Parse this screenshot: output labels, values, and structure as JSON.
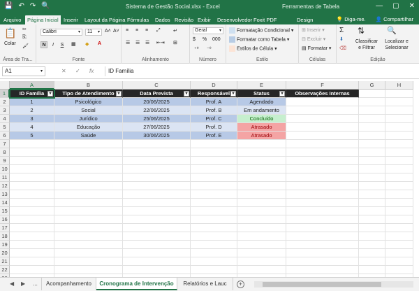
{
  "app": {
    "window_title": "Sistema de Gestão Social.xlsx - Excel",
    "tools_title": "Ferramentas de Tabela",
    "window_controls": [
      "—",
      "▢",
      "✕"
    ]
  },
  "ribbon_tabs": [
    "Arquivo",
    "Página Inicial",
    "Inserir",
    "Layout da Página",
    "Fórmulas",
    "Dados",
    "Revisão",
    "Exibir",
    "Desenvolvedor",
    "Foxit PDF",
    "Design"
  ],
  "ribbon_right": {
    "tell_me": "Diga-me.",
    "share": "Compartilhar"
  },
  "ribbon": {
    "clipboard": {
      "paste": "Colar",
      "label": "Área de Tra..."
    },
    "font": {
      "name": "Calibri",
      "size": "11",
      "bold": "N",
      "italic": "I",
      "underline": "S",
      "label": "Fonte"
    },
    "alignment": {
      "label": "Alinhamento"
    },
    "number": {
      "format": "Geral",
      "percent": "%",
      "thousands": "000",
      "label": "Número"
    },
    "styles": {
      "conditional": "Formatação Condicional",
      "as_table": "Formatar como Tabela",
      "cell_styles": "Estilos de Célula",
      "label": "Estilo"
    },
    "cells": {
      "insert": "Inserir",
      "delete": "Excluir",
      "format": "Formatar",
      "label": "Células"
    },
    "editing": {
      "sort": "Classificar e Filtrar",
      "find": "Localizar e Selecionar",
      "label": "Edição"
    }
  },
  "formula_bar": {
    "name_box": "A1",
    "content": "ID Família"
  },
  "columns": [
    "A",
    "B",
    "C",
    "D",
    "E",
    "F",
    "G",
    "H"
  ],
  "rows": [
    "1",
    "2",
    "3",
    "4",
    "5",
    "6",
    "7",
    "8",
    "9",
    "10",
    "11",
    "12",
    "13",
    "14",
    "15",
    "16",
    "17",
    "18",
    "19",
    "20",
    "21",
    "22",
    "23"
  ],
  "table": {
    "headers": [
      "ID Família",
      "Tipo de Atendimento",
      "Data Prevista",
      "Responsável",
      "Status",
      "Observações Internas"
    ],
    "rows": [
      [
        "1",
        "Psicológico",
        "20/06/2025",
        "Prof. A",
        "Agendado",
        ""
      ],
      [
        "2",
        "Social",
        "22/06/2025",
        "Prof. B",
        "Em andamento",
        ""
      ],
      [
        "3",
        "Jurídico",
        "25/06/2025",
        "Prof. C",
        "Concluído",
        ""
      ],
      [
        "4",
        "Educação",
        "27/06/2025",
        "Prof. D",
        "Atrasado",
        ""
      ],
      [
        "5",
        "Saúde",
        "30/06/2025",
        "Prof. E",
        "Atrasado",
        ""
      ]
    ]
  },
  "sheets": {
    "more": "...",
    "tabs": [
      "Acompanhamento",
      "Cronograma de Intervenção",
      "Relatórios e Lauc"
    ],
    "active": 1
  },
  "colors": {
    "accent": "#217346",
    "header_fill": "#262626",
    "band_dark": "#b7c9e6",
    "band_light": "#dbe4f3",
    "status_done": "#c6efce",
    "status_late": "#f4a4a4"
  }
}
